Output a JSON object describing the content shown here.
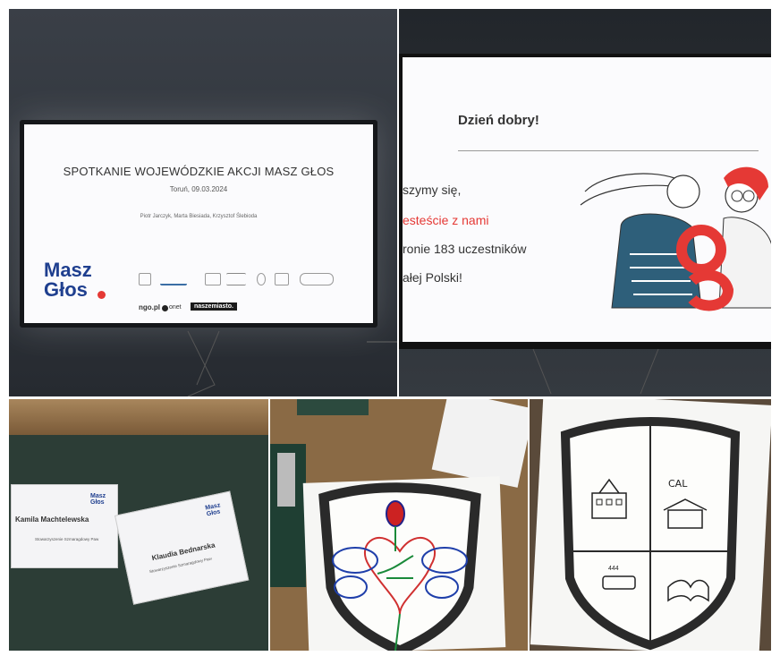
{
  "slide1": {
    "title": "SPOTKANIE WOJEWÓDZKIE AKCJI MASZ GŁOS",
    "subtitle": "Toruń, 09.03.2024",
    "names": "Piotr Jarczyk, Marta Biesiada, Krzysztof Ślebioda",
    "logo_line1": "Masz",
    "logo_line2": "Głos",
    "partner1": "ngo.pl",
    "partner2": "onet",
    "partner3": "naszemiasto."
  },
  "slide2": {
    "title": "Dzień dobry!",
    "line1": "szymy się,",
    "line2": "esteście z nami",
    "line3": "ronie 183 uczestników",
    "line4": "ałej Polski!"
  },
  "badges": {
    "badge1_name": "Kamila Machtelewska",
    "badge1_org": "Stowarzyszenie Szmaragdowy Paw",
    "badge2_name": "Klaudia Bednarska",
    "badge2_org": "Stowarzyszenie Szmaragdowy Paw",
    "logo_line1": "Masz",
    "logo_line2": "Głos"
  },
  "shield2": {
    "label": "CAL",
    "number": "444"
  }
}
